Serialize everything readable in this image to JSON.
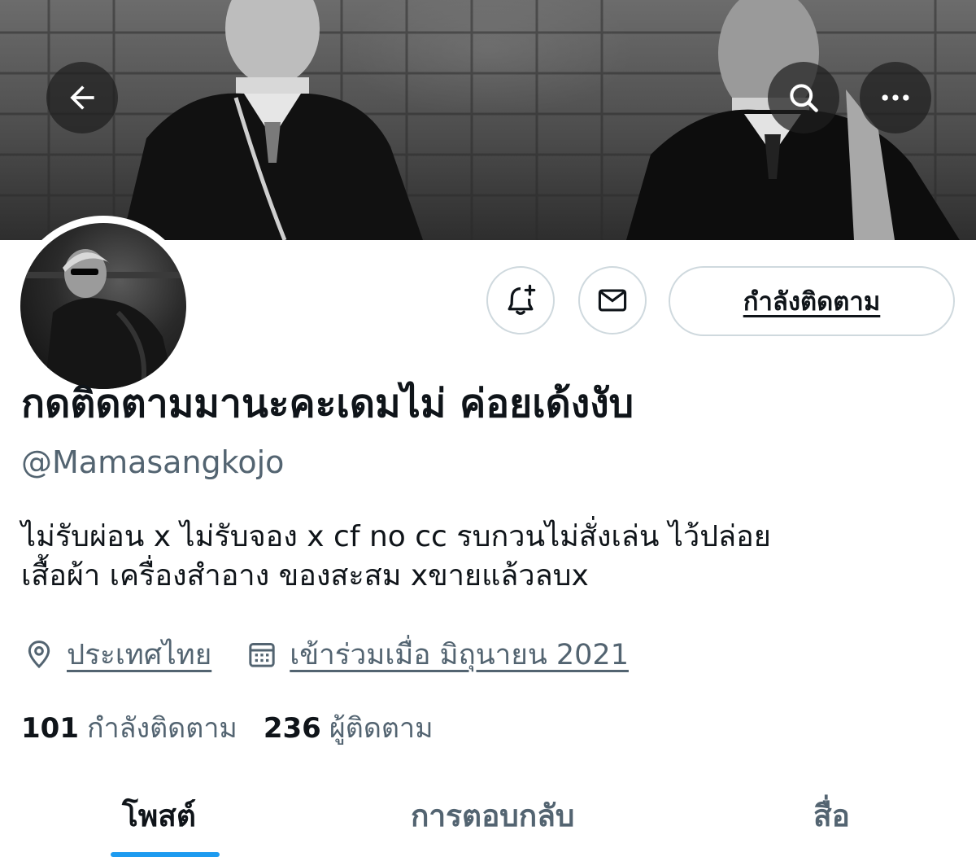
{
  "profile": {
    "display_name": "กดติดตามมานะคะเดมไม่ ค่อยเด้งงับ",
    "handle": "@Mamasangkojo",
    "bio_lines": [
      "ไม่รับผ่อน x ไม่รับจอง x cf no cc รบกวนไม่สั่งเล่น ไว้ปล่อย",
      "เสื้อผ้า เครื่องสำอาง ของสะสม xขายแล้วลบx"
    ],
    "location": "ประเทศไทย",
    "joined": "เข้าร่วมเมื่อ มิถุนายน 2021"
  },
  "actions": {
    "following_label": "กำลังติดตาม"
  },
  "stats": {
    "following_count": "101",
    "following_label": "กำลังติดตาม",
    "followers_count": "236",
    "followers_label": "ผู้ติดตาม"
  },
  "tabs": [
    {
      "label": "โพสต์",
      "active": true
    },
    {
      "label": "การตอบกลับ",
      "active": false
    },
    {
      "label": "สื่อ",
      "active": false
    }
  ],
  "icons": {
    "back": "arrow-left-icon",
    "search": "search-icon",
    "more": "more-icon",
    "notify": "bell-plus-icon",
    "message": "envelope-icon",
    "location": "location-pin-icon",
    "joined": "calendar-icon"
  },
  "colors": {
    "accent": "#1d9bf0",
    "secondary_text": "#536471",
    "border": "#cfd9de"
  }
}
